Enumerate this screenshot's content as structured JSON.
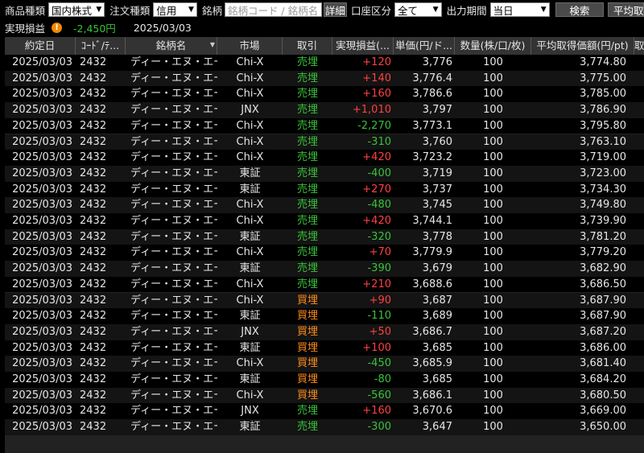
{
  "filters": {
    "product_type_label": "商品種類",
    "product_type_value": "国内株式",
    "order_type_label": "注文種類",
    "order_type_value": "信用",
    "symbol_label": "銘柄",
    "symbol_placeholder": "銘柄コード / 銘柄名",
    "detail_button": "詳細",
    "account_label": "口座区分",
    "account_value": "全て",
    "period_label": "出力期間",
    "period_value": "当日",
    "search_button": "検索",
    "avg_button": "平均取"
  },
  "summary": {
    "label": "実現損益",
    "value": "-2,450円",
    "date": "2025/03/03",
    "colors": {
      "warn": "#f08a00",
      "value": "#39c239"
    }
  },
  "table": {
    "columns": [
      "約定日",
      "ｺｰﾄﾞ/ﾃ...",
      "銘柄名",
      "市場",
      "取引",
      "実現損益(...",
      "単価(円/ド...",
      "数量(株/口/枚)",
      "平均取得価額(円/pt)",
      "取得"
    ],
    "rows": [
      [
        "2025/03/03",
        "2432",
        "ディー・エヌ・エー",
        "Chi-X",
        "売埋",
        "+120",
        "3,776",
        "100",
        "3,774.80"
      ],
      [
        "2025/03/03",
        "2432",
        "ディー・エヌ・エー",
        "Chi-X",
        "売埋",
        "+140",
        "3,776.4",
        "100",
        "3,775.00"
      ],
      [
        "2025/03/03",
        "2432",
        "ディー・エヌ・エー",
        "Chi-X",
        "売埋",
        "+160",
        "3,786.6",
        "100",
        "3,785.00"
      ],
      [
        "2025/03/03",
        "2432",
        "ディー・エヌ・エー",
        "JNX",
        "売埋",
        "+1,010",
        "3,797",
        "100",
        "3,786.90"
      ],
      [
        "2025/03/03",
        "2432",
        "ディー・エヌ・エー",
        "Chi-X",
        "売埋",
        "-2,270",
        "3,773.1",
        "100",
        "3,795.80"
      ],
      [
        "2025/03/03",
        "2432",
        "ディー・エヌ・エー",
        "Chi-X",
        "売埋",
        "-310",
        "3,760",
        "100",
        "3,763.10"
      ],
      [
        "2025/03/03",
        "2432",
        "ディー・エヌ・エー",
        "Chi-X",
        "売埋",
        "+420",
        "3,723.2",
        "100",
        "3,719.00"
      ],
      [
        "2025/03/03",
        "2432",
        "ディー・エヌ・エー",
        "東証",
        "売埋",
        "-400",
        "3,719",
        "100",
        "3,723.00"
      ],
      [
        "2025/03/03",
        "2432",
        "ディー・エヌ・エー",
        "東証",
        "売埋",
        "+270",
        "3,737",
        "100",
        "3,734.30"
      ],
      [
        "2025/03/03",
        "2432",
        "ディー・エヌ・エー",
        "Chi-X",
        "売埋",
        "-480",
        "3,745",
        "100",
        "3,749.80"
      ],
      [
        "2025/03/03",
        "2432",
        "ディー・エヌ・エー",
        "Chi-X",
        "売埋",
        "+420",
        "3,744.1",
        "100",
        "3,739.90"
      ],
      [
        "2025/03/03",
        "2432",
        "ディー・エヌ・エー",
        "東証",
        "売埋",
        "-320",
        "3,778",
        "100",
        "3,781.20"
      ],
      [
        "2025/03/03",
        "2432",
        "ディー・エヌ・エー",
        "Chi-X",
        "売埋",
        "+70",
        "3,779.9",
        "100",
        "3,779.20"
      ],
      [
        "2025/03/03",
        "2432",
        "ディー・エヌ・エー",
        "東証",
        "売埋",
        "-390",
        "3,679",
        "100",
        "3,682.90"
      ],
      [
        "2025/03/03",
        "2432",
        "ディー・エヌ・エー",
        "Chi-X",
        "売埋",
        "+210",
        "3,688.6",
        "100",
        "3,686.50"
      ],
      [
        "2025/03/03",
        "2432",
        "ディー・エヌ・エー",
        "Chi-X",
        "買埋",
        "+90",
        "3,687",
        "100",
        "3,687.90"
      ],
      [
        "2025/03/03",
        "2432",
        "ディー・エヌ・エー",
        "東証",
        "買埋",
        "-110",
        "3,689",
        "100",
        "3,687.90"
      ],
      [
        "2025/03/03",
        "2432",
        "ディー・エヌ・エー",
        "JNX",
        "買埋",
        "+50",
        "3,686.7",
        "100",
        "3,687.20"
      ],
      [
        "2025/03/03",
        "2432",
        "ディー・エヌ・エー",
        "東証",
        "買埋",
        "+100",
        "3,685",
        "100",
        "3,686.00"
      ],
      [
        "2025/03/03",
        "2432",
        "ディー・エヌ・エー",
        "Chi-X",
        "買埋",
        "-450",
        "3,685.9",
        "100",
        "3,681.40"
      ],
      [
        "2025/03/03",
        "2432",
        "ディー・エヌ・エー",
        "東証",
        "買埋",
        "-80",
        "3,685",
        "100",
        "3,684.20"
      ],
      [
        "2025/03/03",
        "2432",
        "ディー・エヌ・エー",
        "Chi-X",
        "買埋",
        "-560",
        "3,686.1",
        "100",
        "3,680.50"
      ],
      [
        "2025/03/03",
        "2432",
        "ディー・エヌ・エー",
        "JNX",
        "売埋",
        "+160",
        "3,670.6",
        "100",
        "3,669.00"
      ],
      [
        "2025/03/03",
        "2432",
        "ディー・エヌ・エー",
        "東証",
        "売埋",
        "-300",
        "3,647",
        "100",
        "3,650.00"
      ]
    ]
  }
}
